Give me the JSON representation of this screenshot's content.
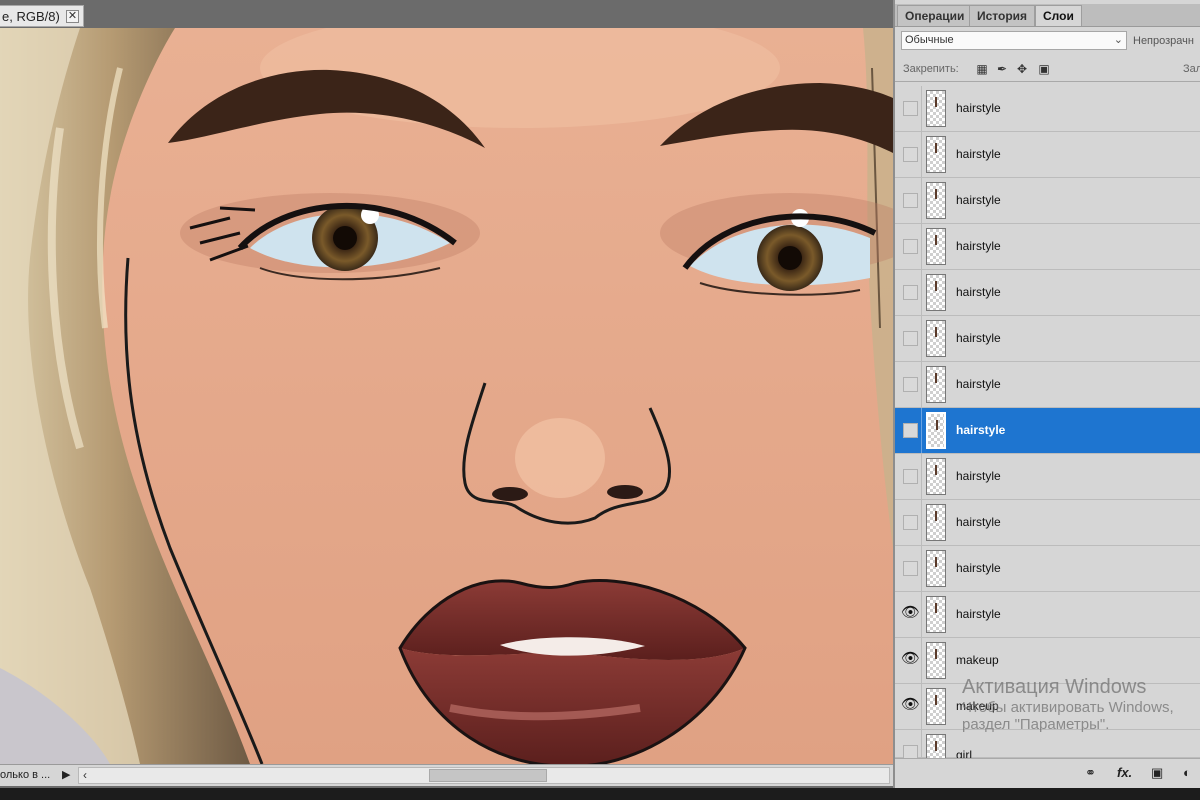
{
  "document": {
    "tab_title": "e, RGB/8)",
    "close_glyph": "✕",
    "zoom_field": "олько в ...",
    "nav_arrow": "▶",
    "scroll_left": "‹"
  },
  "panel": {
    "tabs": [
      {
        "label": "Операции",
        "active": false
      },
      {
        "label": "История",
        "active": false
      },
      {
        "label": "Слои",
        "active": true
      }
    ],
    "blend_mode": "Обычные",
    "opacity_label": "Непрозрачн",
    "lock_label": "Закрепить:",
    "fill_label": "Зал",
    "layers": [
      {
        "name": "hairstyle",
        "visible": false,
        "selected": false
      },
      {
        "name": "hairstyle",
        "visible": false,
        "selected": false
      },
      {
        "name": "hairstyle",
        "visible": false,
        "selected": false
      },
      {
        "name": "hairstyle",
        "visible": false,
        "selected": false
      },
      {
        "name": "hairstyle",
        "visible": false,
        "selected": false
      },
      {
        "name": "hairstyle",
        "visible": false,
        "selected": false
      },
      {
        "name": "hairstyle",
        "visible": false,
        "selected": false
      },
      {
        "name": "hairstyle",
        "visible": false,
        "selected": true
      },
      {
        "name": "hairstyle",
        "visible": false,
        "selected": false
      },
      {
        "name": "hairstyle",
        "visible": false,
        "selected": false
      },
      {
        "name": "hairstyle",
        "visible": false,
        "selected": false
      },
      {
        "name": "hairstyle",
        "visible": true,
        "selected": false
      },
      {
        "name": "makeup",
        "visible": true,
        "selected": false
      },
      {
        "name": "makeup",
        "visible": true,
        "selected": false
      },
      {
        "name": "girl",
        "visible": false,
        "selected": false
      }
    ],
    "footer_fx": "fx."
  },
  "watermark": {
    "line1": "Активация Windows",
    "line2": "Чтобы активировать Windows,",
    "line3": "раздел \"Параметры\"."
  },
  "colors": {
    "selection": "#1e75d0",
    "panel_bg": "#d6d6d6",
    "skin": "#e4a789",
    "lips": "#7a2f2c"
  }
}
